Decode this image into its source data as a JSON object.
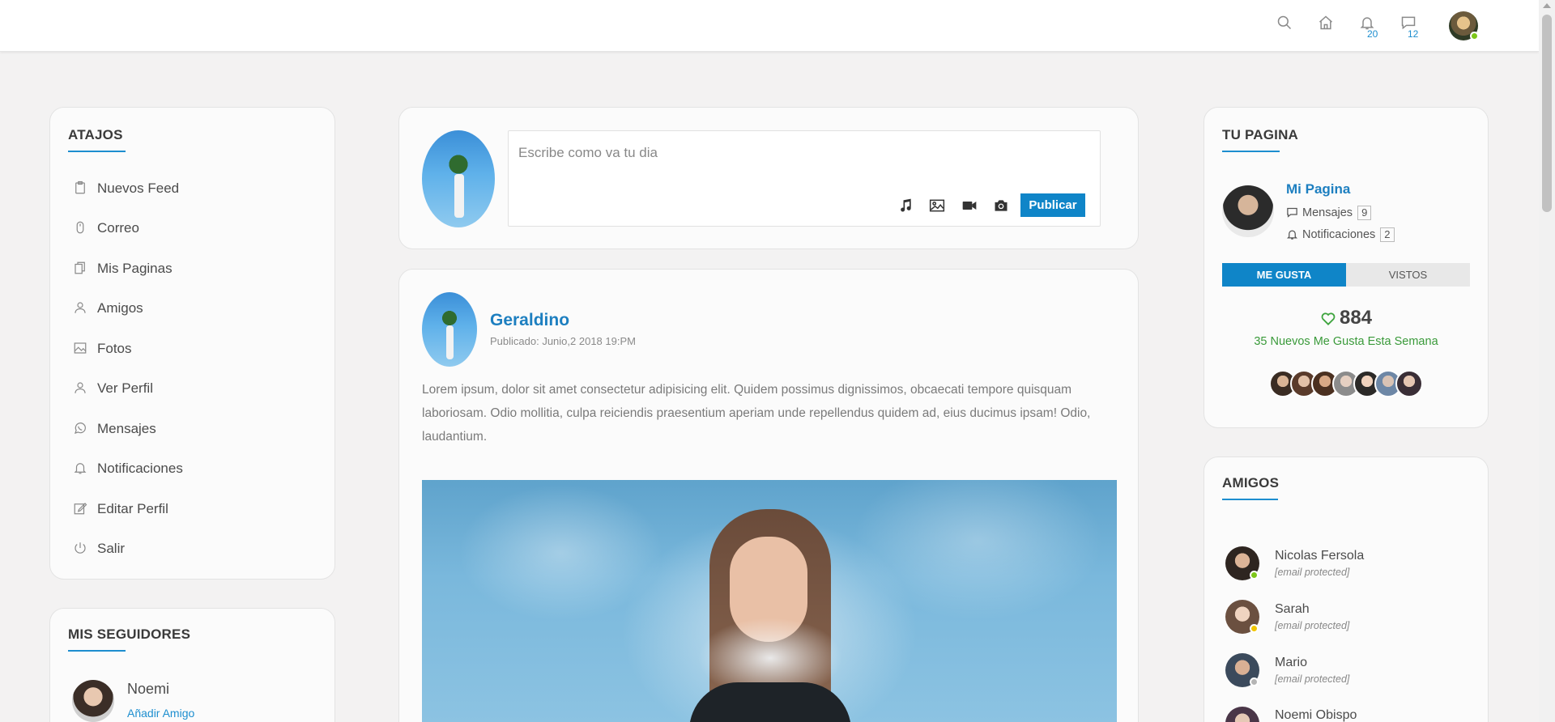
{
  "header": {
    "icons": [
      "search-icon",
      "home-icon",
      "bell-icon",
      "chat-icon"
    ],
    "notifications_count": "20",
    "messages_count": "12"
  },
  "shortcuts": {
    "title": "ATAJOS",
    "items": [
      {
        "label": "Nuevos Feed",
        "icon": "clipboard-icon"
      },
      {
        "label": "Correo",
        "icon": "mouse-icon"
      },
      {
        "label": "Mis Paginas",
        "icon": "pages-icon"
      },
      {
        "label": "Amigos",
        "icon": "user-icon"
      },
      {
        "label": "Fotos",
        "icon": "image-icon"
      },
      {
        "label": "Ver Perfil",
        "icon": "user-icon"
      },
      {
        "label": "Mensajes",
        "icon": "whatsapp-icon"
      },
      {
        "label": "Notificaciones",
        "icon": "bell-icon"
      },
      {
        "label": "Editar Perfil",
        "icon": "edit-icon"
      },
      {
        "label": "Salir",
        "icon": "power-icon"
      }
    ]
  },
  "followers": {
    "title": "MIS SEGUIDORES",
    "items": [
      {
        "name": "Noemi",
        "action": "Añadir Amigo"
      }
    ]
  },
  "composer": {
    "placeholder": "Escribe como va tu dia",
    "publish_label": "Publicar",
    "tools": [
      "music-icon",
      "image-icon",
      "video-icon",
      "camera-icon"
    ]
  },
  "post": {
    "author": "Geraldino",
    "date": "Publicado: Junio,2 2018 19:PM",
    "text": "Lorem ipsum, dolor sit amet consectetur adipisicing elit. Quidem possimus dignissimos, obcaecati tempore quisquam laboriosam. Odio mollitia, culpa reiciendis praesentium aperiam unde repellendus quidem ad, eius ducimus ipsam! Odio, laudantium."
  },
  "page": {
    "title": "TU PAGINA",
    "name": "Mi Pagina",
    "messages_label": "Mensajes",
    "messages_count": "9",
    "notifications_label": "Notificaciones",
    "notifications_count": "2",
    "tab_likes": "ME GUSTA",
    "tab_views": "VISTOS",
    "likes": "884",
    "likes_sub": "35 Nuevos Me Gusta Esta Semana"
  },
  "friends": {
    "title": "AMIGOS",
    "items": [
      {
        "name": "Nicolas Fersola",
        "email": "[email protected]",
        "status_color": "#7cc618"
      },
      {
        "name": "Sarah",
        "email": "[email protected]",
        "status_color": "#f2c500"
      },
      {
        "name": "Mario",
        "email": "[email protected]",
        "status_color": "#b5b5b5"
      },
      {
        "name": "Noemi Obispo",
        "email": "",
        "status_color": "#7cc618"
      }
    ]
  },
  "colors": {
    "accent": "#0f85c8",
    "online": "#7cc618",
    "likes_green": "#3a9a3a"
  }
}
